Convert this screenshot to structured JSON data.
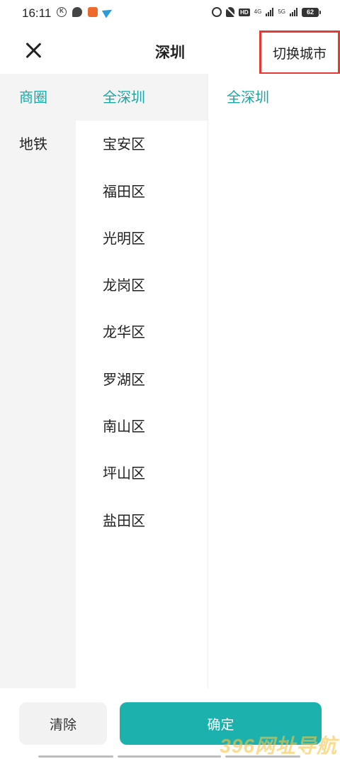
{
  "status_bar": {
    "time": "16:11",
    "battery": "62",
    "network_1": "4G",
    "network_2": "5G",
    "hd_label": "HD"
  },
  "header": {
    "title": "深圳",
    "switch_city_label": "切换城市"
  },
  "categories": [
    {
      "label": "商圈",
      "active": true
    },
    {
      "label": "地铁",
      "active": false
    }
  ],
  "districts": [
    {
      "label": "全深圳",
      "active": true
    },
    {
      "label": "宝安区",
      "active": false
    },
    {
      "label": "福田区",
      "active": false
    },
    {
      "label": "光明区",
      "active": false
    },
    {
      "label": "龙岗区",
      "active": false
    },
    {
      "label": "龙华区",
      "active": false
    },
    {
      "label": "罗湖区",
      "active": false
    },
    {
      "label": "南山区",
      "active": false
    },
    {
      "label": "坪山区",
      "active": false
    },
    {
      "label": "盐田区",
      "active": false
    }
  ],
  "sub_areas": [
    {
      "label": "全深圳",
      "active": true
    }
  ],
  "footer": {
    "clear_label": "清除",
    "confirm_label": "确定"
  },
  "watermark": "396网址导航",
  "colors": {
    "accent": "#1aa7a4",
    "confirm_bg": "#1cb1ad",
    "highlight_border": "#e53935"
  }
}
